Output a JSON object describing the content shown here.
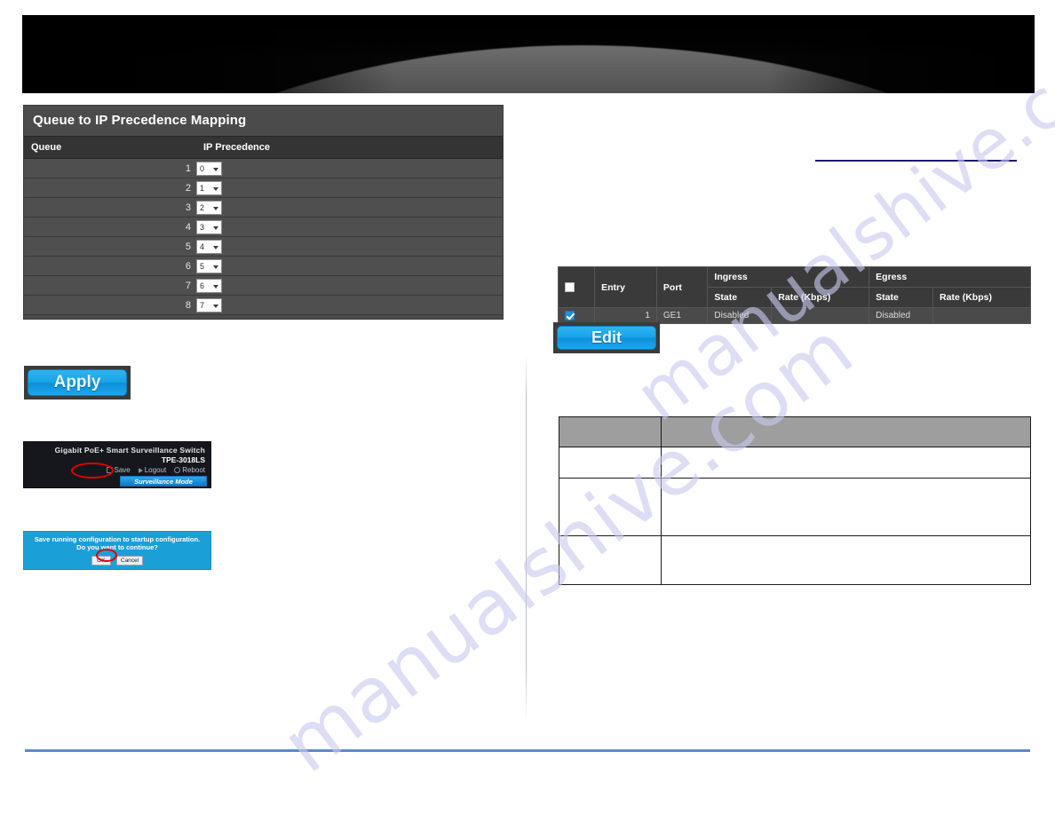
{
  "banner": {
    "alt": "dark-product-banner"
  },
  "left_panel": {
    "title": "Queue to IP Precedence Mapping",
    "columns": {
      "queue": "Queue",
      "precedence": "IP Precedence"
    },
    "rows": [
      {
        "queue": "1",
        "precedence": "0"
      },
      {
        "queue": "2",
        "precedence": "1"
      },
      {
        "queue": "3",
        "precedence": "2"
      },
      {
        "queue": "4",
        "precedence": "3"
      },
      {
        "queue": "5",
        "precedence": "4"
      },
      {
        "queue": "6",
        "precedence": "5"
      },
      {
        "queue": "7",
        "precedence": "6"
      },
      {
        "queue": "8",
        "precedence": "7"
      }
    ]
  },
  "apply": {
    "label": "Apply"
  },
  "device_bar": {
    "title": "Gigabit PoE+ Smart Surveillance Switch",
    "model": "TPE-3018LS",
    "save": "Save",
    "logout": "Logout",
    "reboot": "Reboot",
    "surveillance_mode": "Surveillance Mode"
  },
  "save_dialog": {
    "message": "Save running configuration to startup configuration. Do you want to continue?",
    "ok": "OK",
    "cancel": "Cancel"
  },
  "rate_table": {
    "headers": {
      "entry": "Entry",
      "port": "Port",
      "ingress": "Ingress",
      "egress": "Egress",
      "state": "State",
      "rate": "Rate (Kbps)"
    },
    "rows": [
      {
        "entry": "1",
        "port": "GE1",
        "ingress_state": "Disabled",
        "ingress_rate": "",
        "egress_state": "Disabled",
        "egress_rate": "",
        "checked": true
      }
    ]
  },
  "edit": {
    "label": "Edit"
  },
  "description_table": {
    "header": {
      "c1": "",
      "c2": ""
    },
    "rows": [
      {
        "c1": "",
        "c2": ""
      },
      {
        "c1": "",
        "c2": ""
      },
      {
        "c1": "",
        "c2": ""
      }
    ]
  },
  "watermark": {
    "line1": "manualshive.com",
    "line2": "manualshive.com"
  },
  "colors": {
    "accent_blue": "#16a4e8",
    "footer_rule": "#5b8ac6",
    "panel_dark": "#4b4b4b",
    "navy_rule": "#1a1a6e"
  }
}
